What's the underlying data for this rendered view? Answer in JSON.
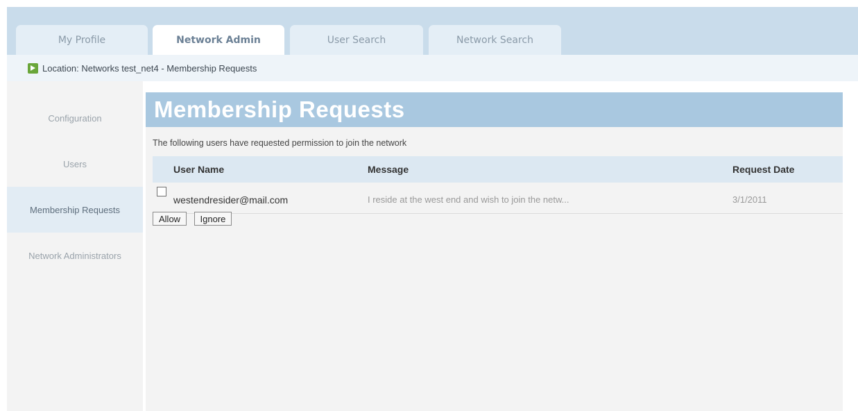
{
  "tabs": [
    {
      "label": "My Profile",
      "active": false
    },
    {
      "label": "Network Admin",
      "active": true
    },
    {
      "label": "User Search",
      "active": false
    },
    {
      "label": "Network Search",
      "active": false
    }
  ],
  "location": {
    "prefix": "Location:",
    "crumbs": [
      "Networks",
      "test_net4",
      "Membership Requests"
    ],
    "separator": "-"
  },
  "sidebar": {
    "items": [
      {
        "label": "Configuration",
        "active": false
      },
      {
        "label": "Users",
        "active": false
      },
      {
        "label": "Membership Requests",
        "active": true
      },
      {
        "label": "Network Administrators",
        "active": false
      }
    ]
  },
  "main": {
    "title": "Membership Requests",
    "intro": "The following users have requested permission to join the network",
    "table": {
      "columns": [
        "User Name",
        "Message",
        "Request Date"
      ],
      "rows": [
        {
          "user": "westendresider@mail.com",
          "message": "I reside at the west end and wish to join the netw...",
          "date": "3/1/2011",
          "checked": false
        }
      ]
    },
    "buttons": {
      "allow": "Allow",
      "ignore": "Ignore"
    }
  },
  "colors": {
    "header_band": "#c9dceb",
    "heading_bg": "#a9c8e0",
    "table_header_bg": "#dce8f2",
    "location_icon": "#6aa63a"
  }
}
